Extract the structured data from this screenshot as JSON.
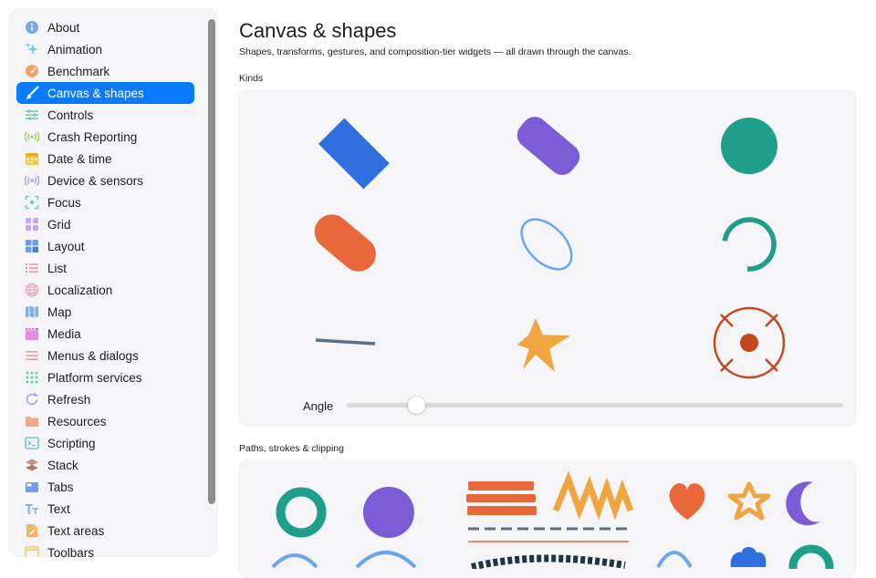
{
  "sidebar": {
    "items": [
      {
        "label": "About",
        "icon": "info-icon",
        "color": "#7aa7ea"
      },
      {
        "label": "Animation",
        "icon": "sparkles-icon",
        "color": "#6ec7e8"
      },
      {
        "label": "Benchmark",
        "icon": "gauge-icon",
        "color": "#f2a36b"
      },
      {
        "label": "Canvas & shapes",
        "icon": "paintbrush-icon",
        "color": "#ffffff",
        "active": true
      },
      {
        "label": "Controls",
        "icon": "sliders-icon",
        "color": "#6fc7a6"
      },
      {
        "label": "Crash Reporting",
        "icon": "broadcast-icon",
        "color": "#9acd5a"
      },
      {
        "label": "Date & time",
        "icon": "calendar-icon",
        "color": "#f2c94c"
      },
      {
        "label": "Device & sensors",
        "icon": "sensor-icon",
        "color": "#a99be8"
      },
      {
        "label": "Focus",
        "icon": "focus-icon",
        "color": "#6ad0b8"
      },
      {
        "label": "Grid",
        "icon": "grid-icon",
        "color": "#c9a7f2"
      },
      {
        "label": "Layout",
        "icon": "layout-icon",
        "color": "#6d9ee8"
      },
      {
        "label": "List",
        "icon": "list-icon",
        "color": "#f08aa3"
      },
      {
        "label": "Localization",
        "icon": "globe-icon",
        "color": "#f0a0b8"
      },
      {
        "label": "Map",
        "icon": "map-icon",
        "color": "#7fb3e8"
      },
      {
        "label": "Media",
        "icon": "film-icon",
        "color": "#e68be0"
      },
      {
        "label": "Menus & dialogs",
        "icon": "menu-icon",
        "color": "#f29a9a"
      },
      {
        "label": "Platform services",
        "icon": "dots-grid-icon",
        "color": "#6fd0a8"
      },
      {
        "label": "Refresh",
        "icon": "refresh-icon",
        "color": "#a99be8"
      },
      {
        "label": "Resources",
        "icon": "folder-icon",
        "color": "#f2a88a"
      },
      {
        "label": "Scripting",
        "icon": "terminal-icon",
        "color": "#5fb6c8"
      },
      {
        "label": "Stack",
        "icon": "stack-icon",
        "color": "#c9937a"
      },
      {
        "label": "Tabs",
        "icon": "tabs-icon",
        "color": "#6d9ee8"
      },
      {
        "label": "Text",
        "icon": "text-icon",
        "color": "#7fb3e8"
      },
      {
        "label": "Text areas",
        "icon": "text-area-icon",
        "color": "#f2b36b"
      },
      {
        "label": "Toolbars",
        "icon": "toolbar-icon",
        "color": "#f2c36b"
      }
    ]
  },
  "main": {
    "title": "Canvas & shapes",
    "subtitle": "Shapes, transforms, gestures, and composition-tier widgets — all drawn through the canvas.",
    "kinds": {
      "label": "Kinds",
      "angle_label": "Angle",
      "angle_value": 0.14
    },
    "paths": {
      "label": "Paths, strokes & clipping"
    }
  },
  "colors": {
    "accent": "#0a7bff",
    "blue": "#2f6fde",
    "purple": "#7b5bd6",
    "teal": "#1f9e89",
    "orange": "#e8683c",
    "light_blue": "#6aa6f0",
    "slate": "#5e6f85",
    "amber": "#f0a640",
    "rust": "#c4481f"
  }
}
